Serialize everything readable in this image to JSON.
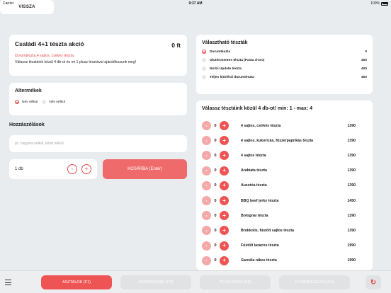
{
  "status": {
    "carrier": "Carrier",
    "time": "9:37 AM",
    "battery": "100%"
  },
  "back_label": "VISSZA",
  "offer": {
    "title": "Családi 4+1 tészta akció",
    "price": "0 ft",
    "selected": "Durumtészta,4 sajtos, csirkés tészta,",
    "description": "Válassz tésztáink közül 4 db-ot és mi 1 plusz tésztával ajándékozunk meg!"
  },
  "altermekek": {
    "title": "Altermékek",
    "options": [
      {
        "label": "Név nélkül",
        "checked": true
      },
      {
        "label": "Név nélkül",
        "checked": false
      }
    ]
  },
  "hozzaszolasok": {
    "title": "Hozzászólások",
    "placeholder": "pl.: hagyma nélkül, köret nélkül"
  },
  "quantity": {
    "value": "1 db",
    "minus": "-",
    "plus": "+"
  },
  "cart_label": "KOSÁRBA (Enter)",
  "valaszthato": {
    "title": "Választható tészták",
    "items": [
      {
        "name": "Durumtészta",
        "price": "0",
        "checked": true
      },
      {
        "name": "Gluténmentes tészta (Pasta d'oro)",
        "price": "400",
        "checked": false
      },
      {
        "name": "Norbi Update tészta",
        "price": "400",
        "checked": false
      },
      {
        "name": "Teljes kiörlésű durumtészta",
        "price": "400",
        "checked": false
      }
    ]
  },
  "pasta_list": {
    "title": "Válassz tésztáink közül 4 db-ot! min: 1 - max: 4",
    "items": [
      {
        "count": "0",
        "name": "4 sajtos, csirkés tészta",
        "price": "1390"
      },
      {
        "count": "0",
        "name": "4 sajtos, kukoricás, fűszerpaprikás tészta",
        "price": "1390"
      },
      {
        "count": "0",
        "name": "4 sajtos tészta",
        "price": "1390"
      },
      {
        "count": "0",
        "name": "Arabiata tészta",
        "price": "1390"
      },
      {
        "count": "0",
        "name": "Ausztria tészta",
        "price": "1390"
      },
      {
        "count": "0",
        "name": "BBQ beef jerky tészta",
        "price": "1450"
      },
      {
        "count": "0",
        "name": "Bolognai tészta",
        "price": "1390"
      },
      {
        "count": "0",
        "name": "Brokkolis, füstölt sajtos tészta",
        "price": "1390"
      },
      {
        "count": "0",
        "name": "Füstölt lazacos tészta",
        "price": "1990"
      },
      {
        "count": "0",
        "name": "Garnéla rákos tészta",
        "price": "1990"
      }
    ]
  },
  "bottom_tabs": [
    {
      "label": "ASZTALOK (F1)",
      "active": true
    },
    {
      "label": "RENDELÉSEK (F2)",
      "active": false
    },
    {
      "label": "TELEFONOS (F3)",
      "active": false
    },
    {
      "label": "FUTÁRKEZELÉS (F4)",
      "active": false
    }
  ],
  "colors": {
    "accent": "#ef5454",
    "accent_light": "#f4a9a9",
    "background": "#e9ecef"
  }
}
